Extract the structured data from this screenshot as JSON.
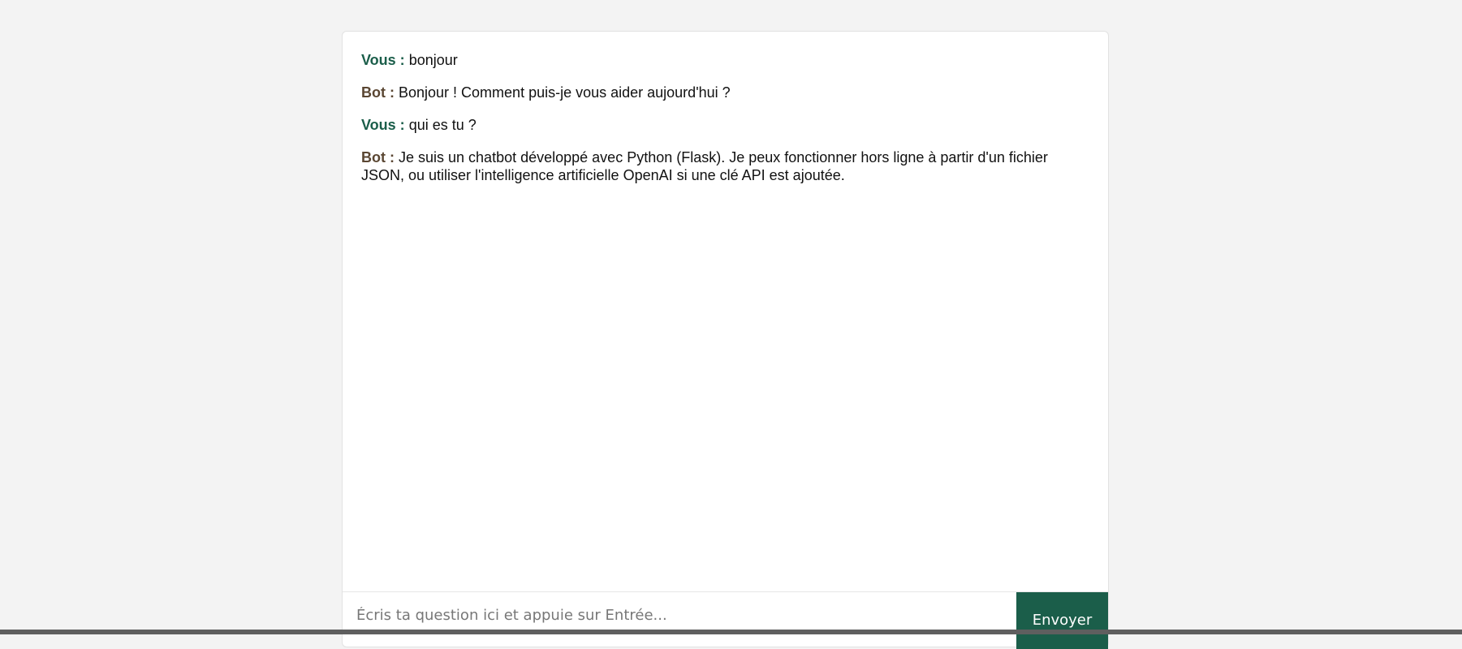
{
  "chat": {
    "messages": [
      {
        "speaker": "Vous :",
        "role": "user",
        "text": "bonjour"
      },
      {
        "speaker": "Bot :",
        "role": "bot",
        "text": "Bonjour ! Comment puis-je vous aider aujourd'hui ?"
      },
      {
        "speaker": "Vous :",
        "role": "user",
        "text": "qui es tu ?"
      },
      {
        "speaker": "Bot :",
        "role": "bot",
        "text": "Je suis un chatbot développé avec Python (Flask). Je peux fonctionner hors ligne à partir d'un fichier JSON, ou utiliser l'intelligence artificielle OpenAI si une clé API est ajoutée."
      }
    ],
    "input": {
      "value": "",
      "placeholder": "Écris ta question ici et appuie sur Entrée..."
    },
    "send_label": "Envoyer"
  },
  "colors": {
    "page_background": "#f3f3f3",
    "card_background": "#ffffff",
    "accent": "#1b5e4a",
    "user_label": "#1b5e4a",
    "bot_label": "#5a4632"
  }
}
